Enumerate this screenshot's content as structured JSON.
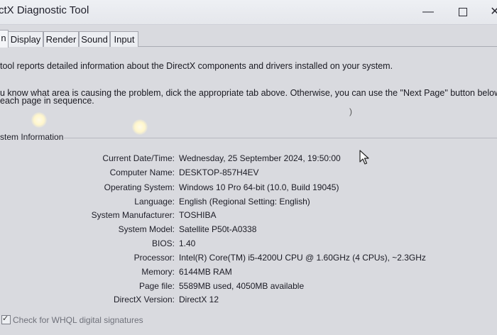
{
  "window": {
    "title": "ctX Diagnostic Tool",
    "minimize_glyph": "—",
    "close_glyph": "✕"
  },
  "tabs": [
    {
      "label": "n"
    },
    {
      "label": "Display"
    },
    {
      "label": "Render"
    },
    {
      "label": "Sound"
    },
    {
      "label": "Input"
    }
  ],
  "intro": {
    "line1": "tool reports detailed information about the DirectX components and drivers installed on your system.",
    "line2": "u know what area is causing the problem, dick the appropriate tab above.  Otherwise, you can use the \"Next Page\" button below to",
    "line3": " each page in sequence."
  },
  "system_info": {
    "heading": "stem Information",
    "rows": [
      {
        "label": "Current Date/Time:",
        "value": "Wednesday, 25 September 2024, 19:50:00"
      },
      {
        "label": "Computer Name:",
        "value": "DESKTOP-857H4EV"
      },
      {
        "label": "Operating System:",
        "value": "Windows 10 Pro 64-bit (10.0, Build 19045)"
      },
      {
        "label": "Language:",
        "value": "English (Regional Setting: English)"
      },
      {
        "label": "System Manufacturer:",
        "value": "TOSHIBA"
      },
      {
        "label": "System Model:",
        "value": "Satellite P50t-A0338"
      },
      {
        "label": "BIOS:",
        "value": "1.40"
      },
      {
        "label": "Processor:",
        "value": "Intel(R) Core(TM) i5-4200U CPU @ 1.60GHz (4 CPUs), ~2.3GHz"
      },
      {
        "label": "Memory:",
        "value": "6144MB RAM"
      },
      {
        "label": "Page file:",
        "value": "5589MB used, 4050MB available"
      },
      {
        "label": "DirectX Version:",
        "value": "DirectX 12"
      }
    ]
  },
  "whql": {
    "label": "Check for WHQL digital signatures",
    "checked": true
  }
}
